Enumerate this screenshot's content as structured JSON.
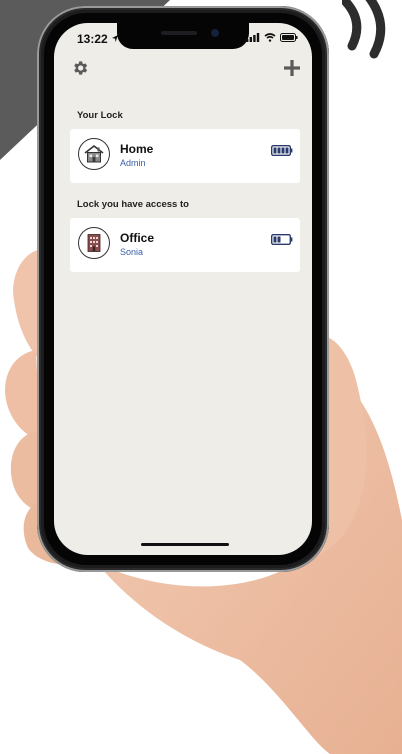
{
  "status_bar": {
    "time": "13:22"
  },
  "toolbar": {
    "settings_icon": "gear-icon",
    "add_icon": "plus-icon"
  },
  "sections": {
    "own": {
      "title": "Your Lock",
      "locks": [
        {
          "name": "Home",
          "role": "Admin",
          "icon": "house-icon",
          "battery_level": 1.0
        }
      ]
    },
    "shared": {
      "title": "Lock you have access to",
      "locks": [
        {
          "name": "Office",
          "role": "Sonia",
          "icon": "office-building-icon",
          "battery_level": 0.5
        }
      ]
    }
  },
  "colors": {
    "screen_bg": "#eeede8",
    "card_bg": "#ffffff",
    "role_text": "#3a5fa8",
    "battery": "#2b3a6b"
  }
}
